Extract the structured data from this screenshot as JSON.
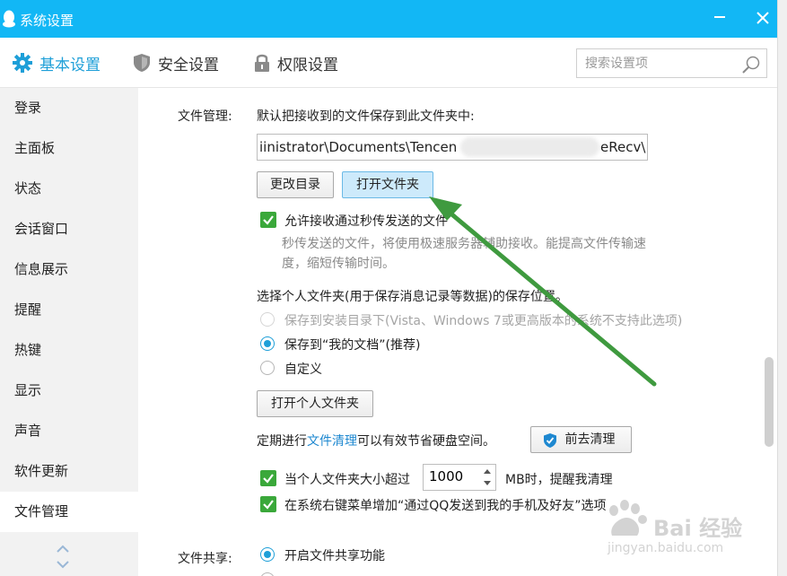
{
  "window": {
    "title": "系统设置"
  },
  "tabs": [
    {
      "label": "基本设置",
      "icon": "gear-icon",
      "active": true
    },
    {
      "label": "安全设置",
      "icon": "shield-icon",
      "active": false
    },
    {
      "label": "权限设置",
      "icon": "lock-icon",
      "active": false
    }
  ],
  "search": {
    "placeholder": "搜索设置项"
  },
  "sidebar": {
    "items": [
      {
        "label": "登录"
      },
      {
        "label": "主面板"
      },
      {
        "label": "状态"
      },
      {
        "label": "会话窗口"
      },
      {
        "label": "信息展示"
      },
      {
        "label": "提醒"
      },
      {
        "label": "热键"
      },
      {
        "label": "显示"
      },
      {
        "label": "声音"
      },
      {
        "label": "软件更新"
      },
      {
        "label": "文件管理",
        "active": true
      }
    ]
  },
  "file_management": {
    "section_label": "文件管理:",
    "save_desc": "默认把接收到的文件保存到此文件夹中:",
    "path_start": "iinistrator\\Documents\\Tencen",
    "path_end": "eRecv\\",
    "change_dir_button": "更改目录",
    "open_folder_button": "打开文件夹",
    "allow_fast_transfer": {
      "label": "允许接收通过秒传发送的文件",
      "checked": true
    },
    "fast_transfer_hint_1": "秒传发送的文件，将使用极速服务器辅助接收。能提高文件传输速",
    "fast_transfer_hint_2": "度，缩短传输时间。",
    "personal_folder_desc": "选择个人文件夹(用于保存消息记录等数据)的保存位置。",
    "radio_install_dir": "保存到安装目录下(Vista、Windows 7或更高版本的系统不支持此选项)",
    "radio_my_docs": "保存到“我的文档”(推荐)",
    "radio_custom": "自定义",
    "open_personal_folder_button": "打开个人文件夹",
    "cleanup_prefix": "定期进行",
    "cleanup_link": "文件清理",
    "cleanup_suffix": "可以有效节省硬盘空间。",
    "go_cleanup_button": "前去清理",
    "size_limit": {
      "prefix": "当个人文件夹大小超过",
      "value": "1000",
      "suffix": "MB时，提醒我清理",
      "checked": true
    },
    "context_menu": {
      "label": "在系统右键菜单增加“通过QQ发送到我的手机及好友”选项",
      "checked": true
    }
  },
  "file_sharing": {
    "section_label": "文件共享:",
    "enable_sharing": "开启文件共享功能"
  },
  "watermark": {
    "main": "Bai 经验",
    "url": "jingyan.baidu.com"
  },
  "colors": {
    "titlebar": "#12b7f5",
    "accent": "#1e9fd8",
    "check_green": "#3aa83a",
    "arrow_green": "#3f9a3f"
  }
}
